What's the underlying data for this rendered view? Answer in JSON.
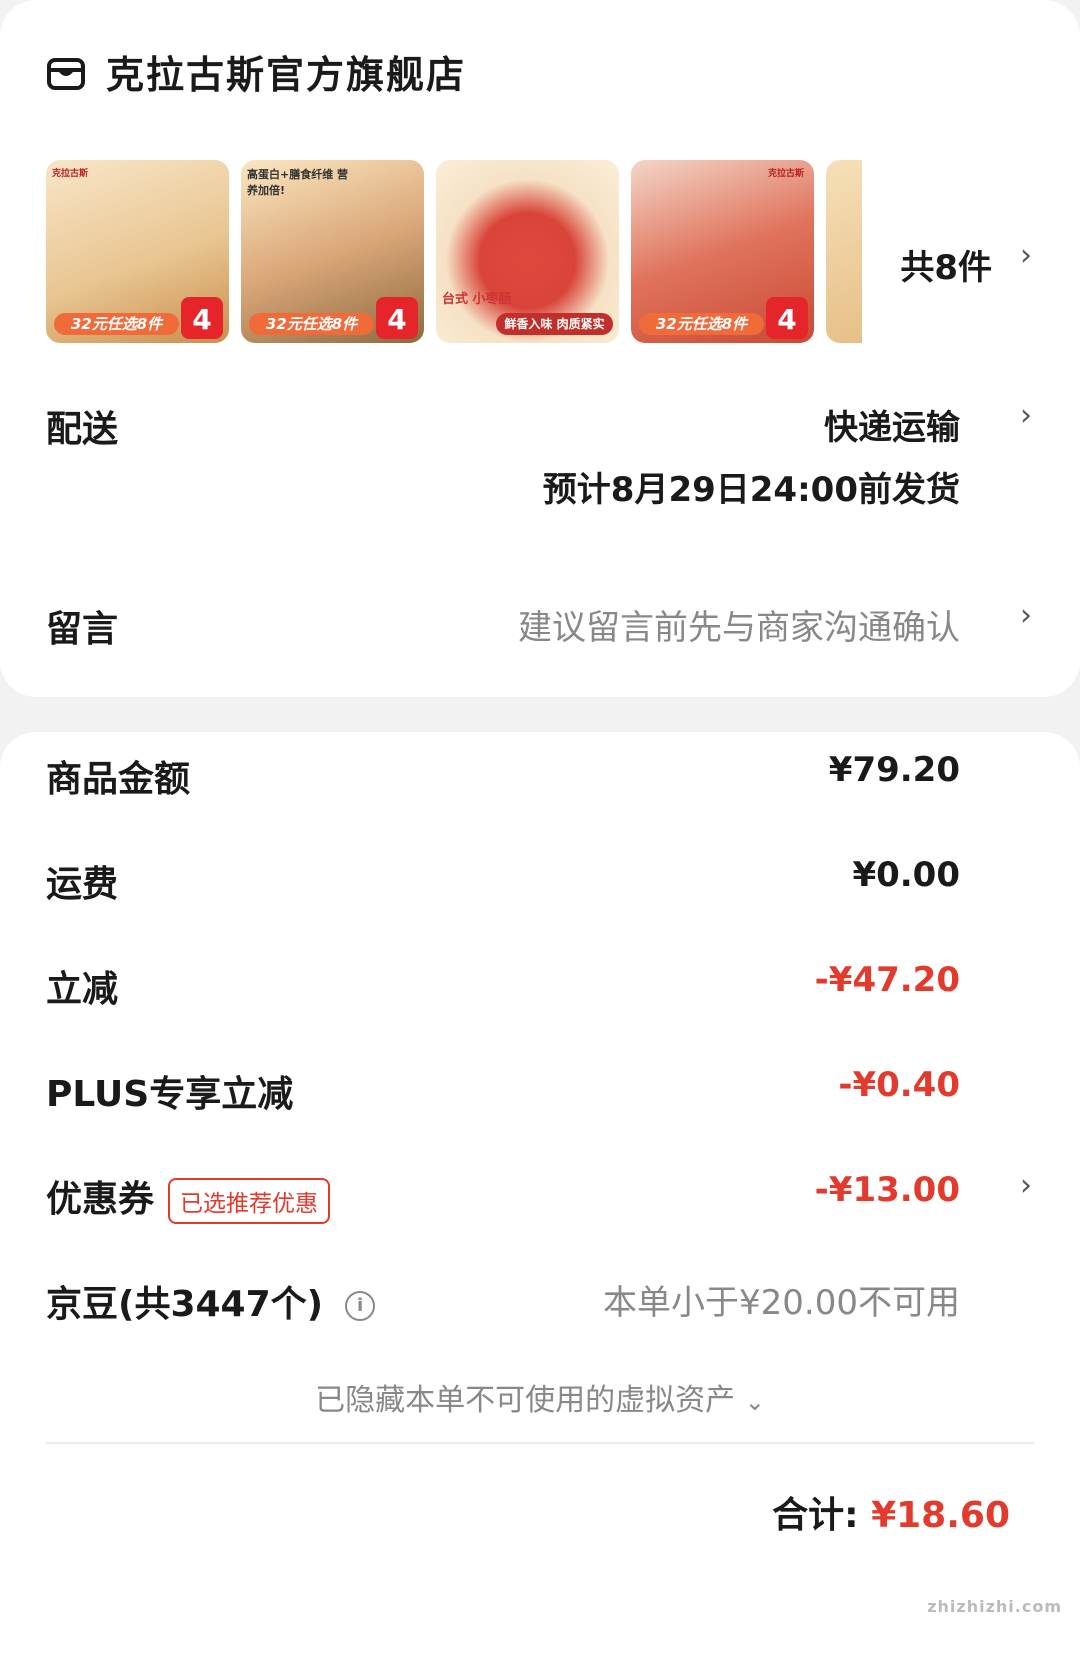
{
  "store": {
    "icon": "store-icon",
    "name": "克拉古斯官方旗舰店"
  },
  "products": [
    {
      "brand": "克拉古斯",
      "promo": "32元任选8件",
      "price": "4"
    },
    {
      "brand": "高蛋白+膳食纤维 营养加倍!",
      "promo": "32元任选8件",
      "price": "4"
    },
    {
      "brand": "台式 小枣肠",
      "promo": "鲜香入味 肉质紧实",
      "price": ""
    },
    {
      "brand": "克拉古斯",
      "promo": "32元任选8件",
      "price": "4"
    }
  ],
  "items_count": "共8件",
  "delivery": {
    "label": "配送",
    "method": "快递运输",
    "estimate": "预计8月29日24:00前发货"
  },
  "message": {
    "label": "留言",
    "placeholder": "建议留言前先与商家沟通确认"
  },
  "summary": {
    "goods_label": "商品金额",
    "goods_value": "¥79.20",
    "shipping_label": "运费",
    "shipping_value": "¥0.00",
    "discount_label": "立减",
    "discount_value": "-¥47.20",
    "plus_label": "PLUS专享立减",
    "plus_value": "-¥0.40",
    "coupon_label": "优惠券",
    "coupon_badge": "已选推荐优惠",
    "coupon_value": "-¥13.00",
    "jd_label": "京豆(共3447个)",
    "jd_value": "本单小于¥20.00不可用"
  },
  "hidden_assets": "已隐藏本单不可使用的虚拟资产",
  "total": {
    "label": "合计:",
    "amount": "¥18.60"
  },
  "watermark": "zhizhizhi.com",
  "colors": {
    "accent_red": "#e23a2c",
    "muted": "#888888"
  }
}
